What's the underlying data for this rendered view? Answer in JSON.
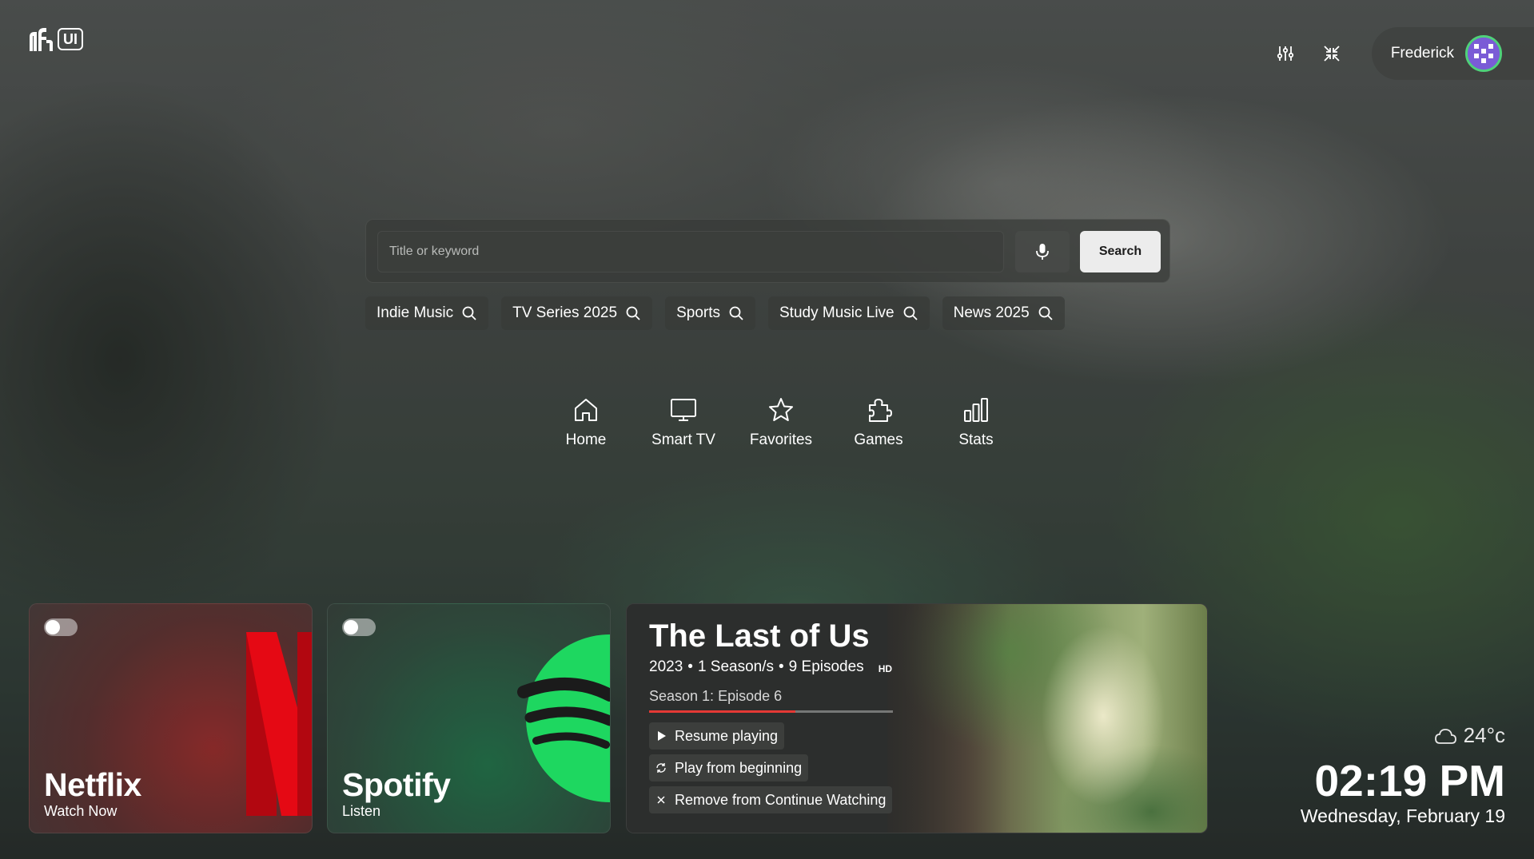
{
  "app": {
    "logo_text": "UI"
  },
  "user": {
    "name": "Frederick"
  },
  "header": {
    "icons": [
      "sliders-icon",
      "collapse-icon"
    ]
  },
  "search": {
    "placeholder": "Title or keyword",
    "button_label": "Search",
    "mic_icon": "microphone-icon"
  },
  "suggestions": [
    {
      "label": "Indie Music"
    },
    {
      "label": "TV Series 2025"
    },
    {
      "label": "Sports"
    },
    {
      "label": "Study Music Live"
    },
    {
      "label": "News 2025"
    }
  ],
  "nav": [
    {
      "label": "Home",
      "icon": "home-icon"
    },
    {
      "label": "Smart TV",
      "icon": "tv-icon"
    },
    {
      "label": "Favorites",
      "icon": "star-icon"
    },
    {
      "label": "Games",
      "icon": "puzzle-icon"
    },
    {
      "label": "Stats",
      "icon": "bar-chart-icon"
    }
  ],
  "apps": [
    {
      "title": "Netflix",
      "subtitle": "Watch Now",
      "enabled": false,
      "brand_color": "#e50914"
    },
    {
      "title": "Spotify",
      "subtitle": "Listen",
      "enabled": false,
      "brand_color": "#1ed760"
    }
  ],
  "continue_watching": {
    "title": "The Last of Us",
    "year": "2023",
    "seasons": "1 Season/s",
    "episodes": "9 Episodes",
    "quality": "HD",
    "current_episode": "Season 1: Episode 6",
    "progress": 0.6,
    "progress_color": "#e53935",
    "actions": [
      {
        "label": "Resume playing",
        "icon": "play-icon"
      },
      {
        "label": "Play from beginning",
        "icon": "restart-icon"
      },
      {
        "label": "Remove from Continue Watching",
        "icon": "close-icon"
      }
    ]
  },
  "weather": {
    "temperature": "24°c",
    "icon": "cloud-icon"
  },
  "clock": {
    "time": "02:19 PM",
    "date": "Wednesday, February 19"
  }
}
